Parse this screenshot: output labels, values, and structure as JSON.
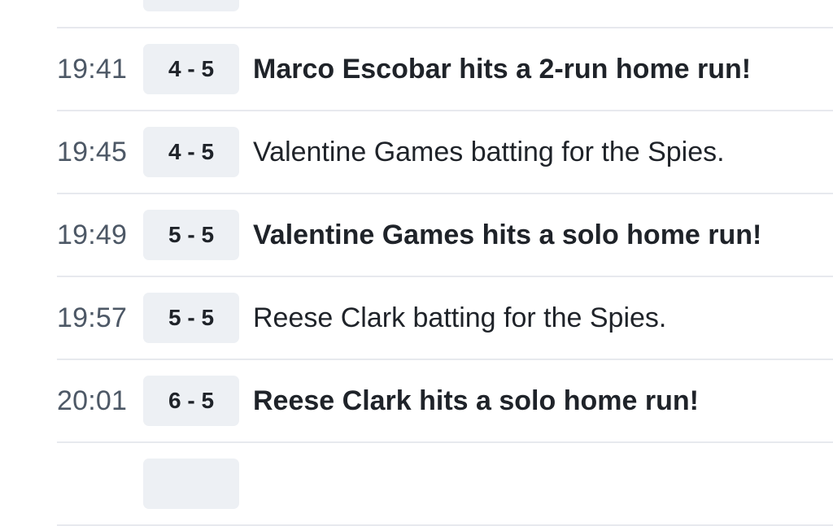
{
  "play_feed": {
    "rows": [
      {
        "time": "",
        "score": "",
        "description": "",
        "highlight": false
      },
      {
        "time": "19:41",
        "score": "4 - 5",
        "description": "Marco Escobar hits a 2-run home run!",
        "highlight": true
      },
      {
        "time": "19:45",
        "score": "4 - 5",
        "description": "Valentine Games batting for the Spies.",
        "highlight": false
      },
      {
        "time": "19:49",
        "score": "5 - 5",
        "description": "Valentine Games hits a solo home run!",
        "highlight": true
      },
      {
        "time": "19:57",
        "score": "5 - 5",
        "description": "Reese Clark batting for the Spies.",
        "highlight": false
      },
      {
        "time": "20:01",
        "score": "6 - 5",
        "description": "Reese Clark hits a solo home run!",
        "highlight": true
      },
      {
        "time": "",
        "score": "",
        "description": "",
        "highlight": false
      }
    ]
  },
  "colors": {
    "row_divider": "#e7e9ee",
    "score_badge_bg": "#edf0f4",
    "time_text": "#4d5866",
    "primary_text": "#1f2329"
  }
}
